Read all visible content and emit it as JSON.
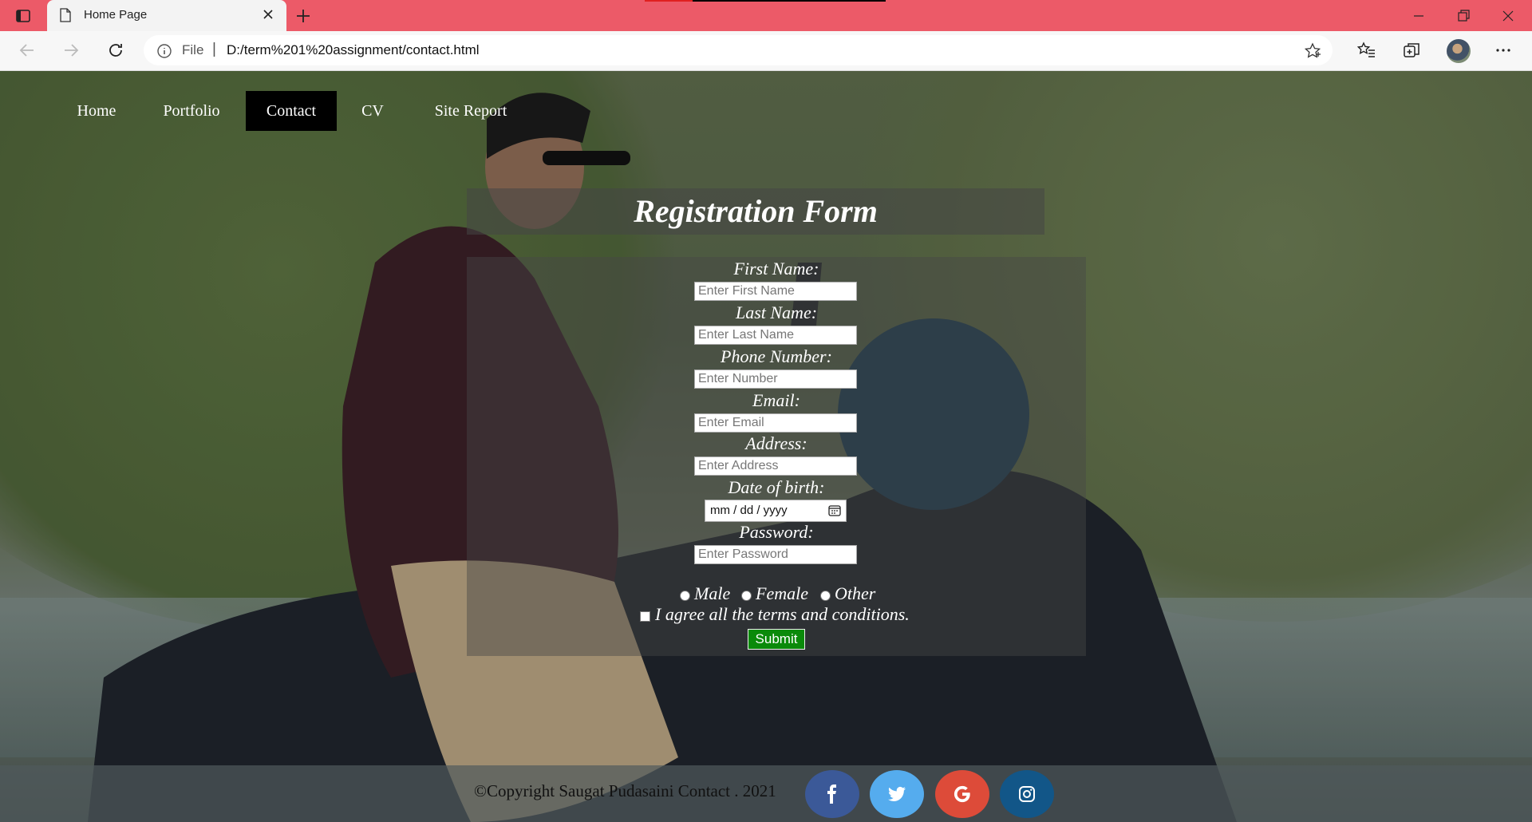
{
  "browser": {
    "tab_title": "Home Page",
    "address_scheme": "File",
    "address_separator": "|",
    "address_path": "D:/term%201%20assignment/contact.html"
  },
  "nav": {
    "items": [
      "Home",
      "Portfolio",
      "Contact",
      "CV",
      "Site Report"
    ],
    "active": "Contact"
  },
  "form": {
    "title": "Registration Form",
    "first_name_label": "First Name:",
    "first_name_placeholder": "Enter First Name",
    "last_name_label": "Last Name:",
    "last_name_placeholder": "Enter Last Name",
    "phone_label": "Phone Number:",
    "phone_placeholder": "Enter Number",
    "email_label": "Email:",
    "email_placeholder": "Enter Email",
    "address_label": "Address:",
    "address_placeholder": "Enter Address",
    "dob_label": "Date of birth:",
    "dob_placeholder": "mm / dd / yyyy",
    "password_label": "Password:",
    "password_placeholder": "Enter Password",
    "gender_options": [
      "Male",
      "Female",
      "Other"
    ],
    "terms_label": "I agree all the terms and conditions.",
    "submit_label": "Submit"
  },
  "footer": {
    "copyright": "©Copyright Saugat Pudasaini Contact . 2021",
    "social": [
      {
        "icon": "facebook-icon",
        "color": "#3b5998"
      },
      {
        "icon": "twitter-icon",
        "color": "#55acee"
      },
      {
        "icon": "google-icon",
        "color": "#dd4b39"
      },
      {
        "icon": "instagram-icon",
        "color": "#125688"
      }
    ]
  }
}
